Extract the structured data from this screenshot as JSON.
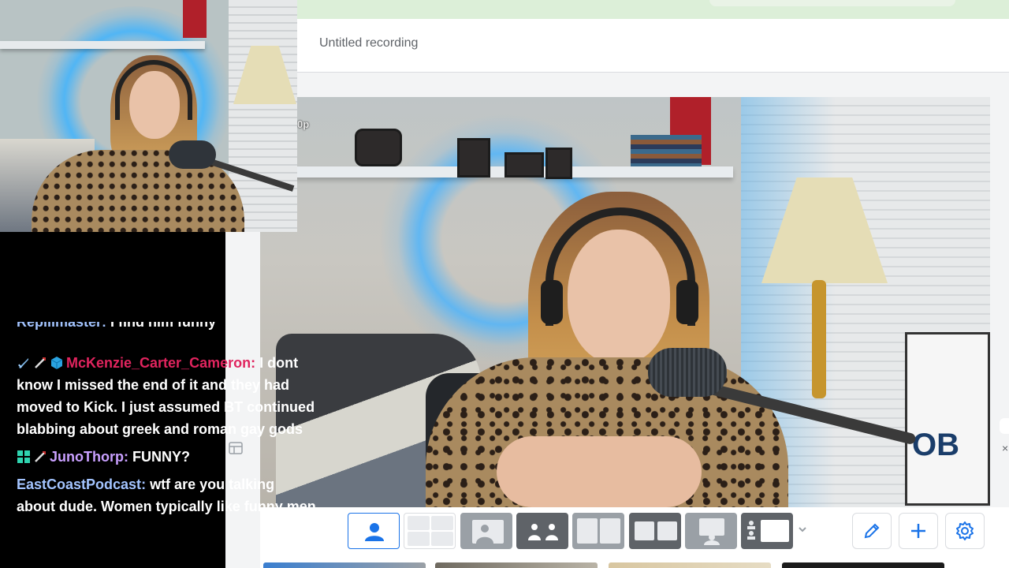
{
  "recording": {
    "title": "Untitled recording"
  },
  "main_camera": {
    "corner_label": "0p",
    "monitor_text": "OB"
  },
  "chat": {
    "partial_message": {
      "user": "Repliimaster",
      "text": "I find him funny"
    },
    "messages": [
      {
        "user": "McKenzie_Carter_Cameron",
        "user_color": "#e0245e",
        "badges": [
          "sword-badge",
          "wand-badge",
          "cube-badge"
        ],
        "text": "I dont know I missed the end of it and they had moved to Kick. I just assumed BT continued blabbing about greek and roman gay gods"
      },
      {
        "user": "JunoThorp",
        "user_color": "#c9a0ff",
        "badges": [
          "grid-badge",
          "wand-badge"
        ],
        "text": "FUNNY?"
      },
      {
        "user": "EastCoastPodcast",
        "user_color": "#a3c4ff",
        "badges": [],
        "text": "wtf are you talking about dude. Women typically like funny men"
      }
    ]
  },
  "toolbar": {
    "layouts": [
      {
        "name": "solo",
        "active": true
      },
      {
        "name": "two-up-grid",
        "active": false
      },
      {
        "name": "speaker-with-side",
        "active": false
      },
      {
        "name": "side-by-side-dark",
        "active": false
      },
      {
        "name": "side-by-side-light",
        "active": false
      },
      {
        "name": "split-boxed",
        "active": false
      },
      {
        "name": "presenter",
        "active": false
      },
      {
        "name": "screen-with-list",
        "active": false
      }
    ],
    "edit_icon": "pencil-icon",
    "add_icon": "plus-icon",
    "settings_icon": "gear-icon"
  },
  "colors": {
    "accent": "#1a73e8",
    "top_bar": "#dcefd8",
    "chat_bg": "#000000"
  }
}
